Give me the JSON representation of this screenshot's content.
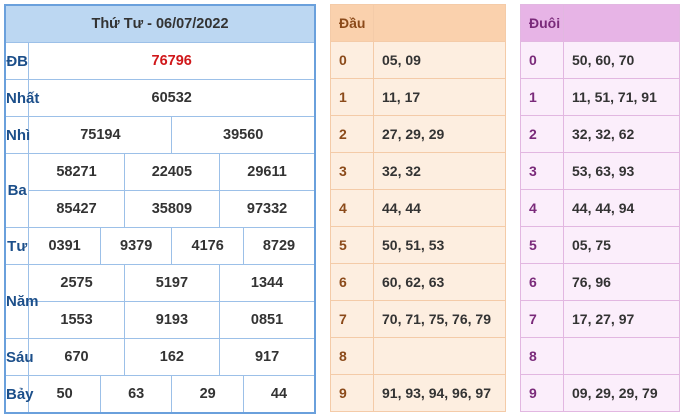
{
  "results": {
    "title": "Thứ Tư - 06/07/2022",
    "rows": {
      "db": {
        "label": "ĐB",
        "values": [
          "76796"
        ]
      },
      "nhat": {
        "label": "Nhất",
        "values": [
          "60532"
        ]
      },
      "nhi": {
        "label": "Nhì",
        "values": [
          "75194",
          "39560"
        ]
      },
      "ba": {
        "label": "Ba",
        "values": [
          "58271",
          "22405",
          "29611",
          "85427",
          "35809",
          "97332"
        ]
      },
      "tu": {
        "label": "Tư",
        "values": [
          "0391",
          "9379",
          "4176",
          "8729"
        ]
      },
      "nam": {
        "label": "Năm",
        "values": [
          "2575",
          "5197",
          "1344",
          "1553",
          "9193",
          "0851"
        ]
      },
      "sau": {
        "label": "Sáu",
        "values": [
          "670",
          "162",
          "917"
        ]
      },
      "bay": {
        "label": "Bảy",
        "values": [
          "50",
          "63",
          "29",
          "44"
        ]
      }
    }
  },
  "dau": {
    "title": "Đầu",
    "rows": [
      {
        "digit": "0",
        "values": "05, 09"
      },
      {
        "digit": "1",
        "values": "11, 17"
      },
      {
        "digit": "2",
        "values": "27, 29, 29"
      },
      {
        "digit": "3",
        "values": "32, 32"
      },
      {
        "digit": "4",
        "values": "44, 44"
      },
      {
        "digit": "5",
        "values": "50, 51, 53"
      },
      {
        "digit": "6",
        "values": "60, 62, 63"
      },
      {
        "digit": "7",
        "values": "70, 71, 75, 76, 79"
      },
      {
        "digit": "8",
        "values": ""
      },
      {
        "digit": "9",
        "values": "91, 93, 94, 96, 97"
      }
    ]
  },
  "duoi": {
    "title": "Đuôi",
    "rows": [
      {
        "digit": "0",
        "values": "50, 60, 70"
      },
      {
        "digit": "1",
        "values": "11, 51, 71, 91"
      },
      {
        "digit": "2",
        "values": "32, 32, 62"
      },
      {
        "digit": "3",
        "values": "53, 63, 93"
      },
      {
        "digit": "4",
        "values": "44, 44, 94"
      },
      {
        "digit": "5",
        "values": "05, 75"
      },
      {
        "digit": "6",
        "values": "76, 96"
      },
      {
        "digit": "7",
        "values": "17, 27, 97"
      },
      {
        "digit": "8",
        "values": ""
      },
      {
        "digit": "9",
        "values": "09, 29, 29, 79"
      }
    ]
  },
  "colors": {
    "results_header": "#bcd7f2",
    "results_border": "#6aa0dc",
    "special_prize": "#d0171a",
    "dau_header": "#fad1ad",
    "dau_body": "#fdeee0",
    "duoi_header": "#e7b4e6",
    "duoi_body": "#fbeefb"
  }
}
